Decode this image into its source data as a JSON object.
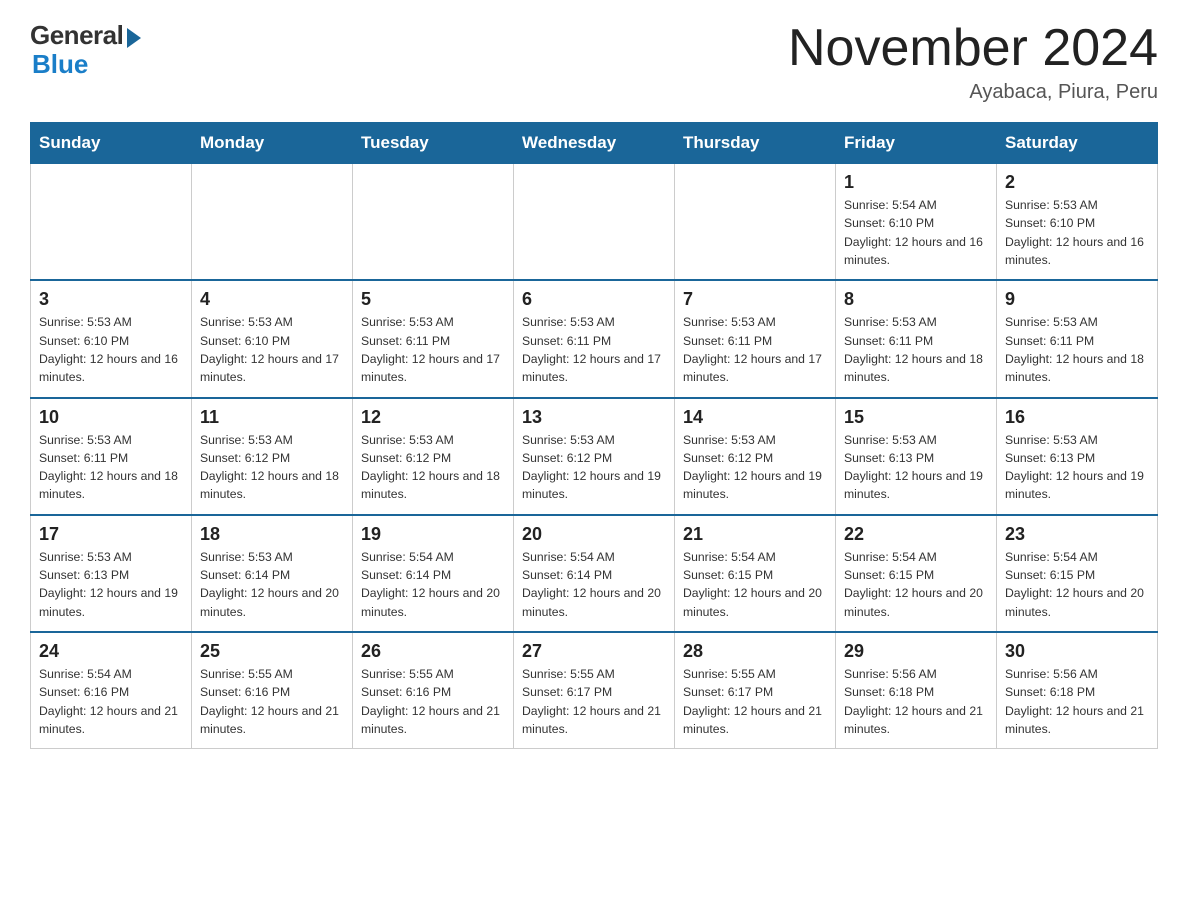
{
  "header": {
    "logo_general": "General",
    "logo_blue": "Blue",
    "month_title": "November 2024",
    "subtitle": "Ayabaca, Piura, Peru"
  },
  "weekdays": [
    "Sunday",
    "Monday",
    "Tuesday",
    "Wednesday",
    "Thursday",
    "Friday",
    "Saturday"
  ],
  "weeks": [
    [
      {
        "day": "",
        "sunrise": "",
        "sunset": "",
        "daylight": ""
      },
      {
        "day": "",
        "sunrise": "",
        "sunset": "",
        "daylight": ""
      },
      {
        "day": "",
        "sunrise": "",
        "sunset": "",
        "daylight": ""
      },
      {
        "day": "",
        "sunrise": "",
        "sunset": "",
        "daylight": ""
      },
      {
        "day": "",
        "sunrise": "",
        "sunset": "",
        "daylight": ""
      },
      {
        "day": "1",
        "sunrise": "Sunrise: 5:54 AM",
        "sunset": "Sunset: 6:10 PM",
        "daylight": "Daylight: 12 hours and 16 minutes."
      },
      {
        "day": "2",
        "sunrise": "Sunrise: 5:53 AM",
        "sunset": "Sunset: 6:10 PM",
        "daylight": "Daylight: 12 hours and 16 minutes."
      }
    ],
    [
      {
        "day": "3",
        "sunrise": "Sunrise: 5:53 AM",
        "sunset": "Sunset: 6:10 PM",
        "daylight": "Daylight: 12 hours and 16 minutes."
      },
      {
        "day": "4",
        "sunrise": "Sunrise: 5:53 AM",
        "sunset": "Sunset: 6:10 PM",
        "daylight": "Daylight: 12 hours and 17 minutes."
      },
      {
        "day": "5",
        "sunrise": "Sunrise: 5:53 AM",
        "sunset": "Sunset: 6:11 PM",
        "daylight": "Daylight: 12 hours and 17 minutes."
      },
      {
        "day": "6",
        "sunrise": "Sunrise: 5:53 AM",
        "sunset": "Sunset: 6:11 PM",
        "daylight": "Daylight: 12 hours and 17 minutes."
      },
      {
        "day": "7",
        "sunrise": "Sunrise: 5:53 AM",
        "sunset": "Sunset: 6:11 PM",
        "daylight": "Daylight: 12 hours and 17 minutes."
      },
      {
        "day": "8",
        "sunrise": "Sunrise: 5:53 AM",
        "sunset": "Sunset: 6:11 PM",
        "daylight": "Daylight: 12 hours and 18 minutes."
      },
      {
        "day": "9",
        "sunrise": "Sunrise: 5:53 AM",
        "sunset": "Sunset: 6:11 PM",
        "daylight": "Daylight: 12 hours and 18 minutes."
      }
    ],
    [
      {
        "day": "10",
        "sunrise": "Sunrise: 5:53 AM",
        "sunset": "Sunset: 6:11 PM",
        "daylight": "Daylight: 12 hours and 18 minutes."
      },
      {
        "day": "11",
        "sunrise": "Sunrise: 5:53 AM",
        "sunset": "Sunset: 6:12 PM",
        "daylight": "Daylight: 12 hours and 18 minutes."
      },
      {
        "day": "12",
        "sunrise": "Sunrise: 5:53 AM",
        "sunset": "Sunset: 6:12 PM",
        "daylight": "Daylight: 12 hours and 18 minutes."
      },
      {
        "day": "13",
        "sunrise": "Sunrise: 5:53 AM",
        "sunset": "Sunset: 6:12 PM",
        "daylight": "Daylight: 12 hours and 19 minutes."
      },
      {
        "day": "14",
        "sunrise": "Sunrise: 5:53 AM",
        "sunset": "Sunset: 6:12 PM",
        "daylight": "Daylight: 12 hours and 19 minutes."
      },
      {
        "day": "15",
        "sunrise": "Sunrise: 5:53 AM",
        "sunset": "Sunset: 6:13 PM",
        "daylight": "Daylight: 12 hours and 19 minutes."
      },
      {
        "day": "16",
        "sunrise": "Sunrise: 5:53 AM",
        "sunset": "Sunset: 6:13 PM",
        "daylight": "Daylight: 12 hours and 19 minutes."
      }
    ],
    [
      {
        "day": "17",
        "sunrise": "Sunrise: 5:53 AM",
        "sunset": "Sunset: 6:13 PM",
        "daylight": "Daylight: 12 hours and 19 minutes."
      },
      {
        "day": "18",
        "sunrise": "Sunrise: 5:53 AM",
        "sunset": "Sunset: 6:14 PM",
        "daylight": "Daylight: 12 hours and 20 minutes."
      },
      {
        "day": "19",
        "sunrise": "Sunrise: 5:54 AM",
        "sunset": "Sunset: 6:14 PM",
        "daylight": "Daylight: 12 hours and 20 minutes."
      },
      {
        "day": "20",
        "sunrise": "Sunrise: 5:54 AM",
        "sunset": "Sunset: 6:14 PM",
        "daylight": "Daylight: 12 hours and 20 minutes."
      },
      {
        "day": "21",
        "sunrise": "Sunrise: 5:54 AM",
        "sunset": "Sunset: 6:15 PM",
        "daylight": "Daylight: 12 hours and 20 minutes."
      },
      {
        "day": "22",
        "sunrise": "Sunrise: 5:54 AM",
        "sunset": "Sunset: 6:15 PM",
        "daylight": "Daylight: 12 hours and 20 minutes."
      },
      {
        "day": "23",
        "sunrise": "Sunrise: 5:54 AM",
        "sunset": "Sunset: 6:15 PM",
        "daylight": "Daylight: 12 hours and 20 minutes."
      }
    ],
    [
      {
        "day": "24",
        "sunrise": "Sunrise: 5:54 AM",
        "sunset": "Sunset: 6:16 PM",
        "daylight": "Daylight: 12 hours and 21 minutes."
      },
      {
        "day": "25",
        "sunrise": "Sunrise: 5:55 AM",
        "sunset": "Sunset: 6:16 PM",
        "daylight": "Daylight: 12 hours and 21 minutes."
      },
      {
        "day": "26",
        "sunrise": "Sunrise: 5:55 AM",
        "sunset": "Sunset: 6:16 PM",
        "daylight": "Daylight: 12 hours and 21 minutes."
      },
      {
        "day": "27",
        "sunrise": "Sunrise: 5:55 AM",
        "sunset": "Sunset: 6:17 PM",
        "daylight": "Daylight: 12 hours and 21 minutes."
      },
      {
        "day": "28",
        "sunrise": "Sunrise: 5:55 AM",
        "sunset": "Sunset: 6:17 PM",
        "daylight": "Daylight: 12 hours and 21 minutes."
      },
      {
        "day": "29",
        "sunrise": "Sunrise: 5:56 AM",
        "sunset": "Sunset: 6:18 PM",
        "daylight": "Daylight: 12 hours and 21 minutes."
      },
      {
        "day": "30",
        "sunrise": "Sunrise: 5:56 AM",
        "sunset": "Sunset: 6:18 PM",
        "daylight": "Daylight: 12 hours and 21 minutes."
      }
    ]
  ]
}
